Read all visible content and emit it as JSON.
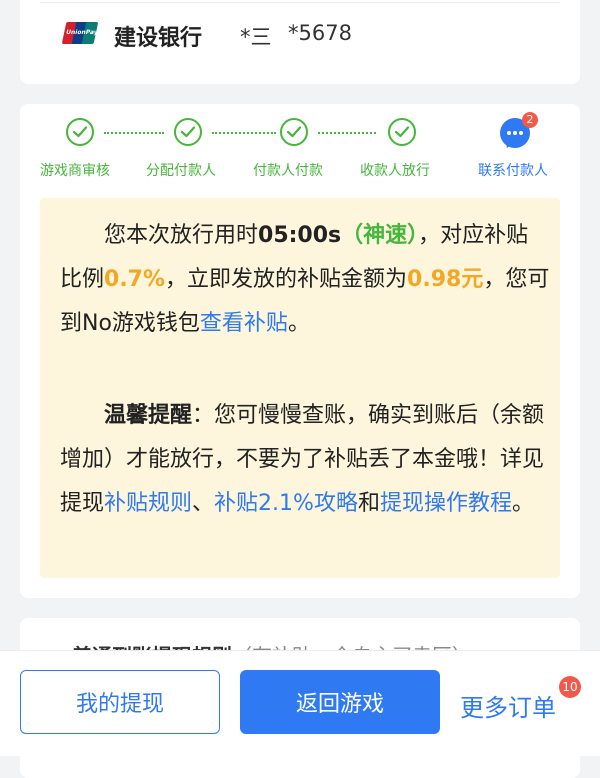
{
  "bank": {
    "logo_text": "UnionPay 银联",
    "name": "建设银行",
    "holder": "*三",
    "number": "*5678"
  },
  "steps": [
    {
      "label": "游戏商审核",
      "status": "done"
    },
    {
      "label": "分配付款人",
      "status": "done"
    },
    {
      "label": "付款人付款",
      "status": "done"
    },
    {
      "label": "收款人放行",
      "status": "done"
    }
  ],
  "contact": {
    "label": "联系付款人",
    "badge": "2"
  },
  "notice": {
    "p1_prefix": "您本次放行用时",
    "time": "05:00s",
    "speed_tag": "（神速）",
    "p1_mid1": "，对应补贴比例",
    "ratio": "0.7%",
    "p1_mid2": "，立即发放的补贴金额为",
    "amount": "0.98元",
    "p1_mid3": "，您可到No游戏钱包",
    "view_link": "查看补贴",
    "p1_end": "。",
    "tip_title": "温馨提醒",
    "tip_text": "：您可慢慢查账，确实到账后（余额增加）才能放行，不要为了补贴丢了本金哦！详见提现",
    "link_rules": "补贴规则",
    "sep": "、",
    "link_strategy": "补贴2.1%攻略",
    "and": "和",
    "link_tutorial": "提现操作教程",
    "end": "。"
  },
  "rules_section": {
    "title": "普通到账提现规则",
    "subtitle": "（有补贴，全自主买卖区）"
  },
  "bottom": {
    "withdraw_label": "我的提现",
    "return_label": "返回游戏",
    "more_orders_label": "更多订单",
    "orders_badge": "10"
  },
  "colors": {
    "accent": "#2f7af2",
    "success": "#46b63c",
    "highlight": "#f5a623",
    "notice_bg": "#fdf6dc",
    "badge": "#f15a4a"
  }
}
